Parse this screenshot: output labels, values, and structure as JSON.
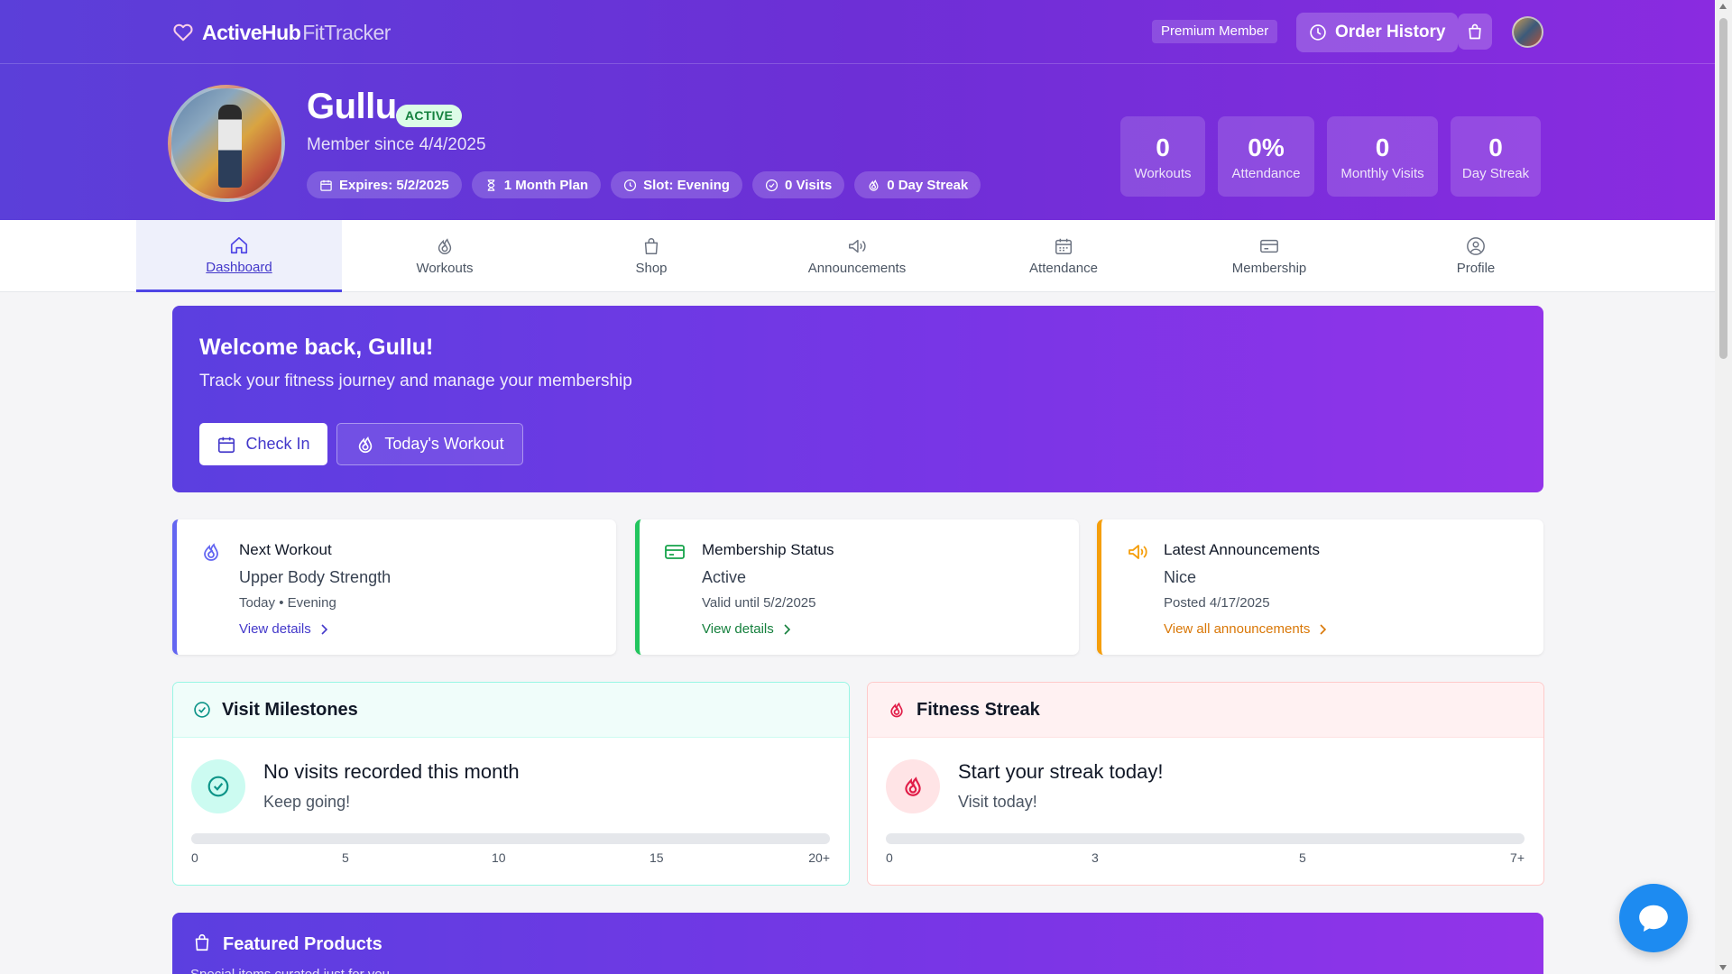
{
  "brand": {
    "name": "ActiveHub",
    "sub": "FitTracker",
    "icon": "heart-icon"
  },
  "topbar": {
    "premium_label": "Premium Member",
    "order_history_label": "Order History"
  },
  "profile": {
    "name": "Gullu",
    "status_badge": "ACTIVE",
    "member_since": "Member since 4/4/2025",
    "chips": {
      "expires": "Expires: 5/2/2025",
      "plan": "1 Month Plan",
      "slot": "Slot: Evening",
      "visits": "0 Visits",
      "streak": "0 Day Streak"
    },
    "stats": {
      "workouts": {
        "value": "0",
        "label": "Workouts"
      },
      "attendance": {
        "value": "0%",
        "label": "Attendance"
      },
      "monthly_visits": {
        "value": "0",
        "label": "Monthly Visits"
      },
      "day_streak": {
        "value": "0",
        "label": "Day Streak"
      }
    }
  },
  "tabs": {
    "dashboard": "Dashboard",
    "workouts": "Workouts",
    "shop": "Shop",
    "announcements": "Announcements",
    "attendance": "Attendance",
    "membership": "Membership",
    "profile": "Profile",
    "active": "Dashboard"
  },
  "welcome": {
    "title": "Welcome back, Gullu!",
    "subtitle": "Track your fitness journey and manage your membership",
    "check_in_label": "Check In",
    "todays_workout_label": "Today's Workout"
  },
  "cards": {
    "next_workout": {
      "title": "Next Workout",
      "main": "Upper Body Strength",
      "sub": "Today • Evening",
      "link": "View details",
      "accent": "#6366f1"
    },
    "membership": {
      "title": "Membership Status",
      "main": "Active",
      "sub": "Valid until 5/2/2025",
      "link": "View details",
      "accent": "#22c55e"
    },
    "announcements": {
      "title": "Latest Announcements",
      "main": "Nice",
      "sub": "Posted 4/17/2025",
      "link": "View all announcements",
      "accent": "#f59e0b"
    }
  },
  "visit_milestones": {
    "title": "Visit Milestones",
    "headline": "No visits recorded this month",
    "sub": "Keep going!",
    "progress": 0,
    "scale": [
      "0",
      "5",
      "10",
      "15",
      "20+"
    ]
  },
  "fitness_streak": {
    "title": "Fitness Streak",
    "headline": "Start your streak today!",
    "sub": "Visit today!",
    "progress": 0,
    "scale": [
      "0",
      "3",
      "5",
      "7+"
    ]
  },
  "featured": {
    "title": "Featured Products",
    "subtitle": "Special items curated just for you"
  },
  "colors": {
    "brand_gradient_start": "#5b3fd9",
    "brand_gradient_end": "#8a2be0",
    "tab_active": "#4338ca",
    "chat_button": "#1d8bf1"
  }
}
